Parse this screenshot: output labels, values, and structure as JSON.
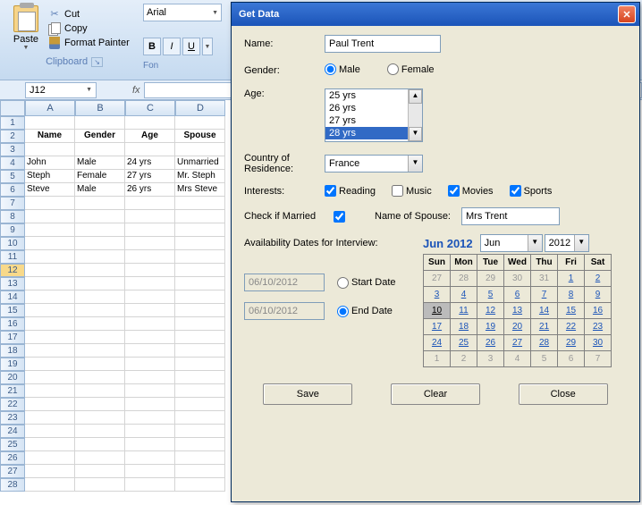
{
  "ribbon": {
    "paste": "Paste",
    "cut": "Cut",
    "copy": "Copy",
    "fmtpainter": "Format Painter",
    "clipboard_label": "Clipboard",
    "font_name": "Arial",
    "font_label": "Fon"
  },
  "namebox": "J12",
  "colheaders": [
    "A",
    "B",
    "C",
    "D"
  ],
  "rowcount": 28,
  "selrow": 12,
  "table": {
    "headers": [
      "Name",
      "Gender",
      "Age",
      "Spouse"
    ],
    "rows": [
      [
        "John",
        "Male",
        "24 yrs",
        "Unmarried"
      ],
      [
        "Steph",
        "Female",
        "27 yrs",
        "Mr. Steph"
      ],
      [
        "Steve",
        "Male",
        "26 yrs",
        "Mrs Steve"
      ]
    ]
  },
  "dialog": {
    "title": "Get Data",
    "labels": {
      "name": "Name:",
      "gender": "Gender:",
      "age": "Age:",
      "country": "Country of Residence:",
      "interests": "Interests:",
      "married": "Check if Married",
      "spouse": "Name of Spouse:",
      "avail": "Availability Dates for Interview:",
      "start": "Start Date",
      "end": "End Date"
    },
    "name_value": "Paul Trent",
    "gender_options": [
      "Male",
      "Female"
    ],
    "gender_selected": "Male",
    "age_options": [
      "25 yrs",
      "26 yrs",
      "27 yrs",
      "28 yrs"
    ],
    "age_selected": "28 yrs",
    "country_value": "France",
    "interests": [
      {
        "label": "Reading",
        "checked": true
      },
      {
        "label": "Music",
        "checked": false
      },
      {
        "label": "Movies",
        "checked": true
      },
      {
        "label": "Sports",
        "checked": true
      }
    ],
    "married_checked": true,
    "spouse_value": "Mrs Trent",
    "start_date": "06/10/2012",
    "end_date": "06/10/2012",
    "end_selected": true,
    "buttons": {
      "save": "Save",
      "clear": "Clear",
      "close": "Close"
    }
  },
  "calendar": {
    "title": "Jun 2012",
    "month_sel": "Jun",
    "year_sel": "2012",
    "dow": [
      "Sun",
      "Mon",
      "Tue",
      "Wed",
      "Thu",
      "Fri",
      "Sat"
    ],
    "weeks": [
      [
        {
          "d": 27,
          "o": 1
        },
        {
          "d": 28,
          "o": 1
        },
        {
          "d": 29,
          "o": 1
        },
        {
          "d": 30,
          "o": 1
        },
        {
          "d": 31,
          "o": 1
        },
        {
          "d": 1
        },
        {
          "d": 2
        }
      ],
      [
        {
          "d": 3
        },
        {
          "d": 4
        },
        {
          "d": 5
        },
        {
          "d": 6
        },
        {
          "d": 7
        },
        {
          "d": 8
        },
        {
          "d": 9
        }
      ],
      [
        {
          "d": 10,
          "t": 1
        },
        {
          "d": 11
        },
        {
          "d": 12
        },
        {
          "d": 13
        },
        {
          "d": 14
        },
        {
          "d": 15
        },
        {
          "d": 16
        }
      ],
      [
        {
          "d": 17
        },
        {
          "d": 18
        },
        {
          "d": 19
        },
        {
          "d": 20
        },
        {
          "d": 21
        },
        {
          "d": 22
        },
        {
          "d": 23
        }
      ],
      [
        {
          "d": 24
        },
        {
          "d": 25
        },
        {
          "d": 26
        },
        {
          "d": 27
        },
        {
          "d": 28
        },
        {
          "d": 29
        },
        {
          "d": 30
        }
      ],
      [
        {
          "d": 1,
          "o": 1
        },
        {
          "d": 2,
          "o": 1
        },
        {
          "d": 3,
          "o": 1
        },
        {
          "d": 4,
          "o": 1
        },
        {
          "d": 5,
          "o": 1
        },
        {
          "d": 6,
          "o": 1
        },
        {
          "d": 7,
          "o": 1
        }
      ]
    ]
  }
}
